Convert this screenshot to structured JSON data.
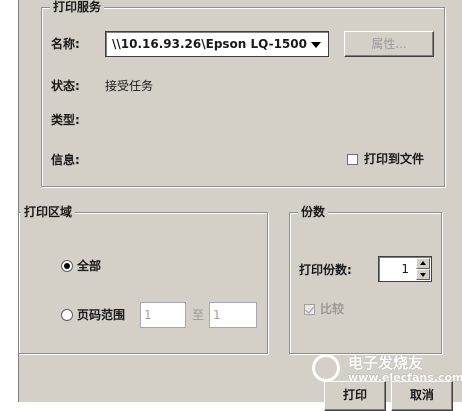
{
  "print_service": {
    "legend": "打印服务",
    "name_label": "名称:",
    "printer_value": "\\\\10.16.93.26\\Epson LQ-1500",
    "properties_button": "属性...",
    "status_label": "状态:",
    "status_value": "接受任务",
    "type_label": "类型:",
    "info_label": "信息:",
    "print_to_file_label": "打印到文件"
  },
  "print_range": {
    "legend": "打印区域",
    "all_label": "全部",
    "pages_label": "页码范围",
    "from_value": "1",
    "to_label": "至",
    "to_value": "1"
  },
  "copies": {
    "legend": "份数",
    "count_label": "打印份数:",
    "count_value": "1",
    "collate_label": "比较"
  },
  "footer": {
    "print_button": "打印",
    "cancel_button": "取消"
  },
  "watermark": {
    "line1": "电子发烧友",
    "line2": "www.elecfans.com"
  }
}
